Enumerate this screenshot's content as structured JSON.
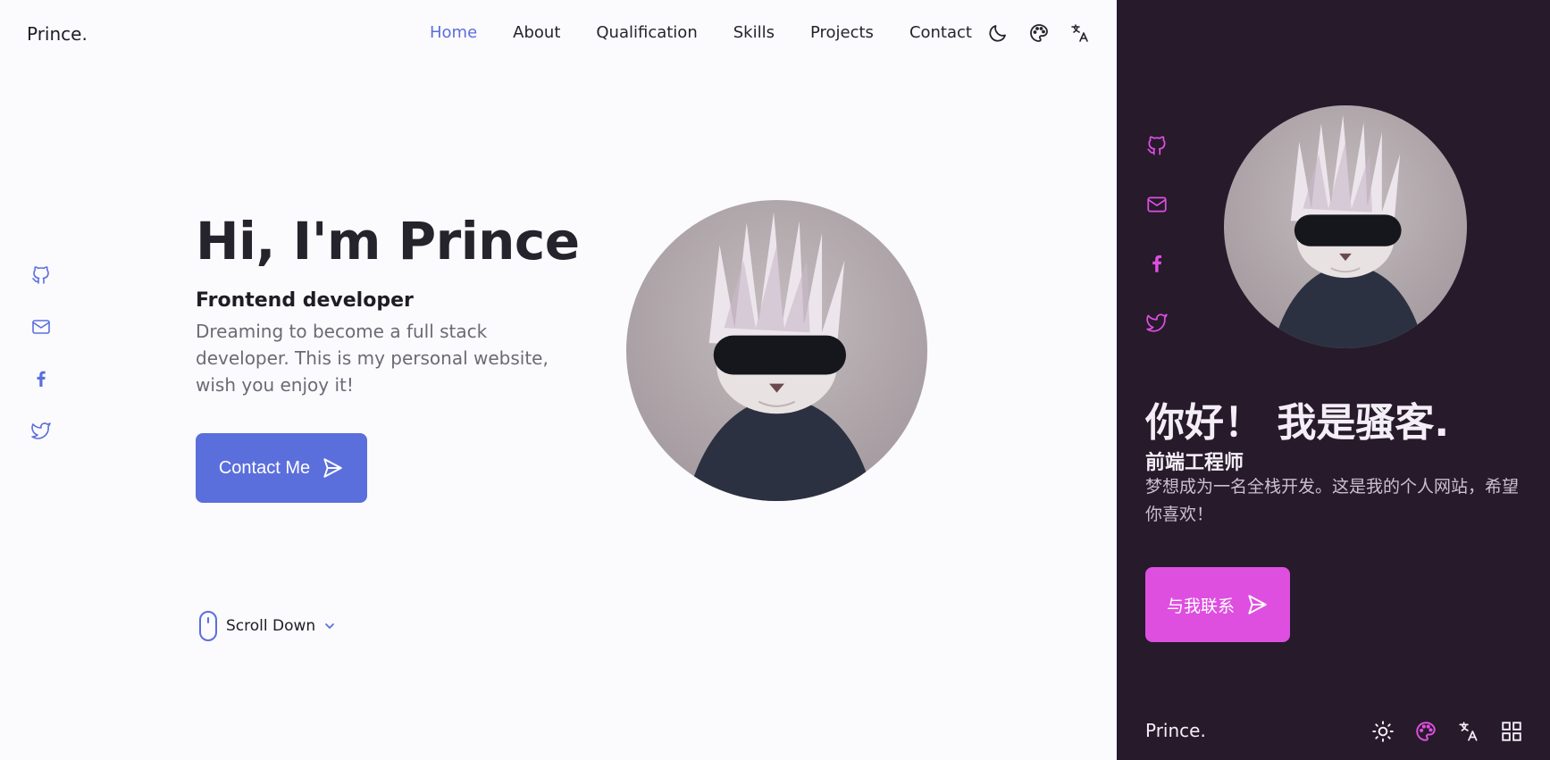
{
  "brand": "Prince.",
  "nav": {
    "items": [
      {
        "label": "Home",
        "active": true
      },
      {
        "label": "About"
      },
      {
        "label": "Qualification"
      },
      {
        "label": "Skills"
      },
      {
        "label": "Projects"
      },
      {
        "label": "Contact"
      }
    ],
    "icons": [
      "moon-icon",
      "palette-icon",
      "translate-icon"
    ]
  },
  "socials": [
    "github-icon",
    "mail-icon",
    "facebook-icon",
    "twitter-icon"
  ],
  "hero": {
    "title": "Hi, I'm Prince",
    "subtitle": "Frontend developer",
    "description": "Dreaming to become a full stack developer. This is my personal website, wish you enjoy it!",
    "button_label": "Contact Me",
    "scroll_label": "Scroll Down"
  },
  "dark": {
    "title": "你好！ 我是骚客.",
    "subtitle": "前端工程师",
    "description": "梦想成为一名全栈开发。这是我的个人网站，希望你喜欢！",
    "button_label": "与我联系",
    "footer_brand": "Prince.",
    "footer_icons": [
      "sun-icon",
      "palette-icon",
      "translate-icon",
      "grid-icon"
    ]
  },
  "colors": {
    "accent_light": "#5b6fdc",
    "accent_dark": "#de4fe0",
    "dark_bg": "#261a2b",
    "light_bg": "#fbfafd"
  }
}
